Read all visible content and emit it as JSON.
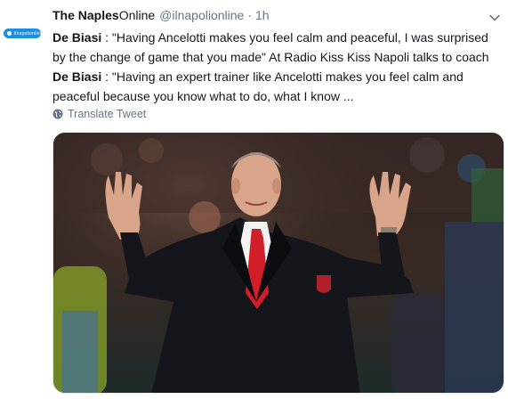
{
  "tweet": {
    "display_name_bold": "The Naples",
    "display_name_rest": "Online",
    "handle": "@ilnapolionline",
    "separator": "·",
    "time": "1h",
    "menu_icon": "chevron-down-icon",
    "avatar_text": "ilnapolionline",
    "body": {
      "name_line1": "De  Biasi",
      "text_line1": " : \"Having Ancelotti makes you feel calm and peaceful, I was surprised by the change of game that you made\" At Radio Kiss Kiss Napoli talks to coach ",
      "name_line2a": "De",
      "name_line2b": "Biasi",
      "text_line2": " : \"Having an expert trainer like Ancelotti makes you feel calm and peaceful because you know what to do, what I know ..."
    },
    "translate_label": "Translate Tweet",
    "translate_icon": "globe-icon",
    "colors": {
      "accent": "#1d8fe1",
      "muted": "#657786",
      "text": "#14171a"
    }
  }
}
